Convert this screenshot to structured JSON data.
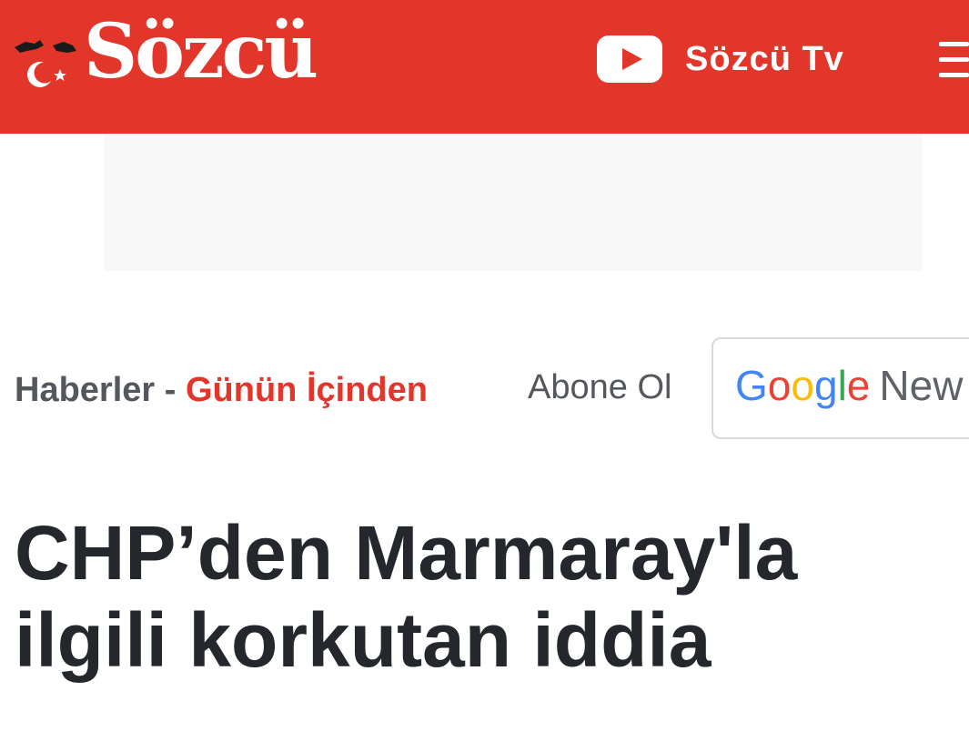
{
  "header": {
    "logo_text": "Sözcü",
    "tv_label": "Sözcü Tv",
    "icons": {
      "logo": "sozcu-logo-icon",
      "youtube": "youtube-play-icon",
      "menu": "hamburger-menu-icon"
    },
    "background_color": "#e2362b"
  },
  "breadcrumb": {
    "home": "Haberler",
    "separator": " - ",
    "section": "Günün İçinden"
  },
  "subscribe": {
    "label": "Abone Ol",
    "google_news": {
      "brand_letters": [
        "G",
        "o",
        "o",
        "g",
        "l",
        "e"
      ],
      "word": "New"
    }
  },
  "article": {
    "title": "CHP’den Marmaray'la ilgili korkutan iddia"
  },
  "colors": {
    "brand_red": "#e2362b",
    "text_dark": "#24272b",
    "text_gray": "#54575b"
  }
}
